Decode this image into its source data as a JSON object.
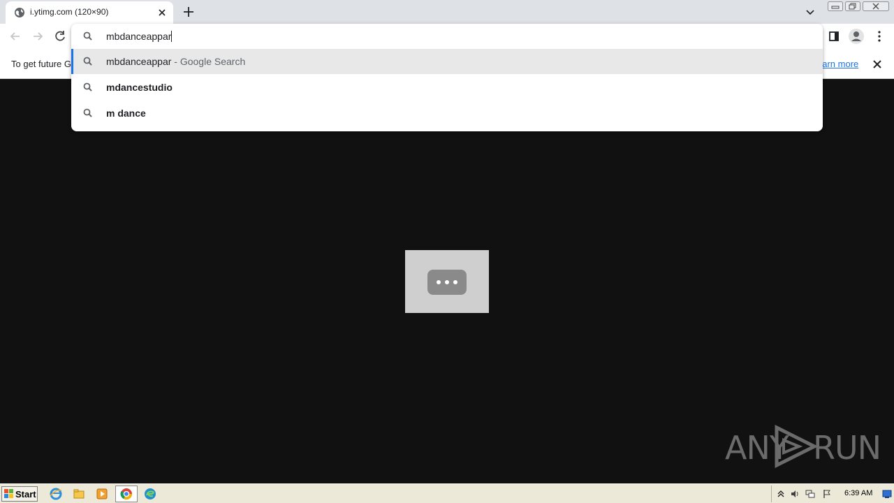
{
  "browser": {
    "tab": {
      "title": "i.ytimg.com (120×90)",
      "favicon": "globe-icon"
    },
    "omnibox": {
      "input_value": "mbdanceappar",
      "suggestions": [
        {
          "text": "mbdanceappar",
          "suffix": " - Google Search",
          "icon": "search-icon",
          "selected": true
        },
        {
          "text": "mdancestudio",
          "suffix": "",
          "icon": "search-icon",
          "selected": false
        },
        {
          "text": "m dance",
          "suffix": "",
          "icon": "search-icon",
          "selected": false
        }
      ]
    },
    "infobar": {
      "text": "To get future G",
      "link": "earn more"
    }
  },
  "page": {
    "image_bg": "#cfcfcf",
    "background": "#111111"
  },
  "watermark": {
    "text_left": "ANY",
    "text_right": "RUN"
  },
  "taskbar": {
    "start_label": "Start",
    "clock": "6:39 AM"
  },
  "colors": {
    "accent": "#1a73e8",
    "tab_strip": "#dee1e6"
  }
}
